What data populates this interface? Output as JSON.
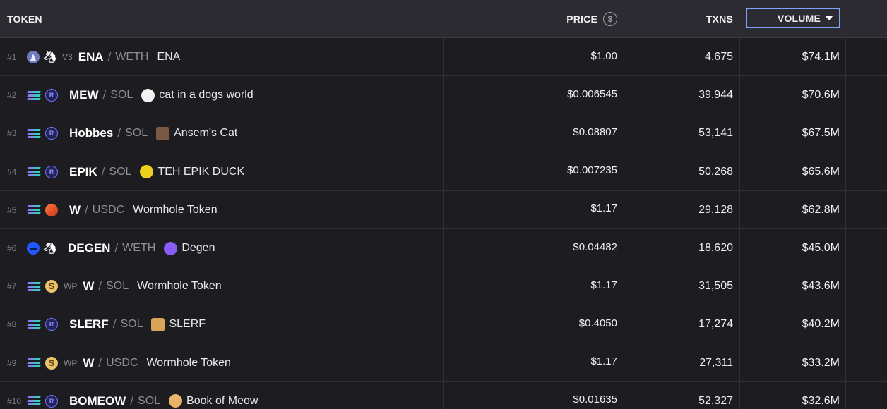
{
  "header": {
    "token": "TOKEN",
    "price": "PRICE",
    "price_icon": "$",
    "txns": "TXNS",
    "volume": "VOLUME"
  },
  "rows": [
    {
      "rank": "#1",
      "chain": "ethereum-icon",
      "dex": "uniswap-icon",
      "version": "V3",
      "symbol": "ENA",
      "quote": "WETH",
      "logo": "",
      "name": "ENA",
      "price": "$1.00",
      "txns": "4,675",
      "volume": "$74.1M"
    },
    {
      "rank": "#2",
      "chain": "solana-icon",
      "dex": "raydium-icon",
      "version": "",
      "symbol": "MEW",
      "quote": "SOL",
      "logo": "cat-logo-icon",
      "name": "cat in a dogs world",
      "price": "$0.006545",
      "txns": "39,944",
      "volume": "$70.6M"
    },
    {
      "rank": "#3",
      "chain": "solana-icon",
      "dex": "raydium-icon",
      "version": "",
      "symbol": "Hobbes",
      "quote": "SOL",
      "logo": "hobbes-logo-icon",
      "name": "Ansem's Cat",
      "price": "$0.08807",
      "txns": "53,141",
      "volume": "$67.5M"
    },
    {
      "rank": "#4",
      "chain": "solana-icon",
      "dex": "raydium-icon",
      "version": "",
      "symbol": "EPIK",
      "quote": "SOL",
      "logo": "duck-logo-icon",
      "name": "TEH EPIK DUCK",
      "price": "$0.007235",
      "txns": "50,268",
      "volume": "$65.6M"
    },
    {
      "rank": "#5",
      "chain": "solana-icon",
      "dex": "orca-icon",
      "version": "",
      "symbol": "W",
      "quote": "USDC",
      "logo": "",
      "name": "Wormhole Token",
      "price": "$1.17",
      "txns": "29,128",
      "volume": "$62.8M"
    },
    {
      "rank": "#6",
      "chain": "base-icon",
      "dex": "uniswap-icon",
      "version": "",
      "symbol": "DEGEN",
      "quote": "WETH",
      "logo": "degen-logo-icon",
      "name": "Degen",
      "price": "$0.04482",
      "txns": "18,620",
      "volume": "$45.0M"
    },
    {
      "rank": "#7",
      "chain": "solana-icon",
      "dex": "wp-icon",
      "version": "WP",
      "symbol": "W",
      "quote": "SOL",
      "logo": "",
      "name": "Wormhole Token",
      "price": "$1.17",
      "txns": "31,505",
      "volume": "$43.6M"
    },
    {
      "rank": "#8",
      "chain": "solana-icon",
      "dex": "raydium-icon",
      "version": "",
      "symbol": "SLERF",
      "quote": "SOL",
      "logo": "slerf-logo-icon",
      "name": "SLERF",
      "price": "$0.4050",
      "txns": "17,274",
      "volume": "$40.2M"
    },
    {
      "rank": "#9",
      "chain": "solana-icon",
      "dex": "wp-icon",
      "version": "WP",
      "symbol": "W",
      "quote": "USDC",
      "logo": "",
      "name": "Wormhole Token",
      "price": "$1.17",
      "txns": "27,311",
      "volume": "$33.2M"
    },
    {
      "rank": "#10",
      "chain": "solana-icon",
      "dex": "raydium-icon",
      "version": "",
      "symbol": "BOMEOW",
      "quote": "SOL",
      "logo": "meow-logo-icon",
      "name": "Book of Meow",
      "price": "$0.01635",
      "txns": "52,327",
      "volume": "$32.6M"
    }
  ]
}
